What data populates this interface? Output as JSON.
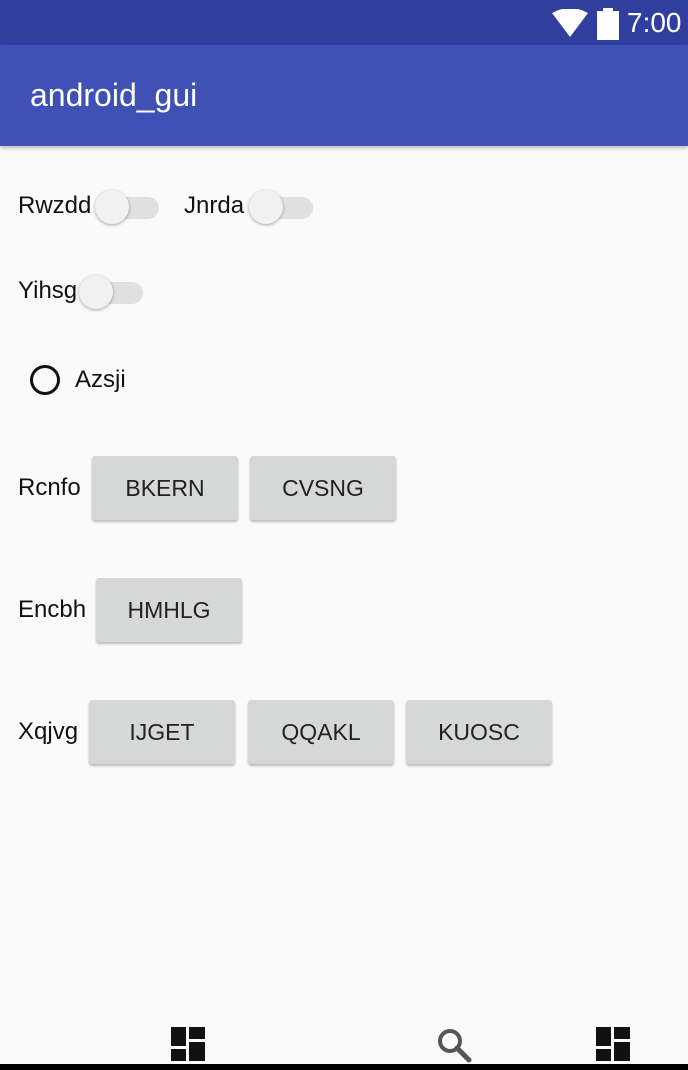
{
  "status_bar": {
    "time": "7:00",
    "icons": [
      "wifi-icon",
      "battery-icon"
    ],
    "color": "#303f9f"
  },
  "app_bar": {
    "title": "android_gui",
    "color": "#3f51b5"
  },
  "switches": [
    {
      "label": "Rwzdd",
      "checked": false
    },
    {
      "label": "Jnrda",
      "checked": false
    },
    {
      "label": "Yihsg",
      "checked": false
    }
  ],
  "radio": {
    "label": "Azsji",
    "checked": false
  },
  "button_groups": [
    {
      "label": "Rcnfo",
      "buttons": [
        "BKERN",
        "CVSNG"
      ]
    },
    {
      "label": "Encbh",
      "buttons": [
        "HMHLG"
      ]
    },
    {
      "label": "Xqjvg",
      "buttons": [
        "IJGET",
        "QQAKL",
        "KUOSC"
      ]
    }
  ],
  "bottom_nav": {
    "icons": [
      "dashboard-icon",
      "search-icon",
      "dashboard-icon"
    ]
  }
}
